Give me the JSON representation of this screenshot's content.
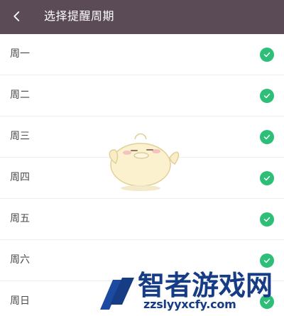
{
  "header": {
    "back_icon": "chevron-left-icon",
    "title": "选择提醒周期"
  },
  "days": [
    {
      "label": "周一",
      "checked": true
    },
    {
      "label": "周二",
      "checked": true
    },
    {
      "label": "周三",
      "checked": true
    },
    {
      "label": "周四",
      "checked": true
    },
    {
      "label": "周五",
      "checked": true
    },
    {
      "label": "周六",
      "checked": true
    },
    {
      "label": "周日",
      "checked": true
    }
  ],
  "check_icon": "checkmark-icon",
  "colors": {
    "header_bg": "#5b4b57",
    "check": "#2dbe78",
    "watermark_blue": "#153c84"
  },
  "watermark": {
    "title": "智者游戏网",
    "url": "zzslyyxcfy.com"
  }
}
